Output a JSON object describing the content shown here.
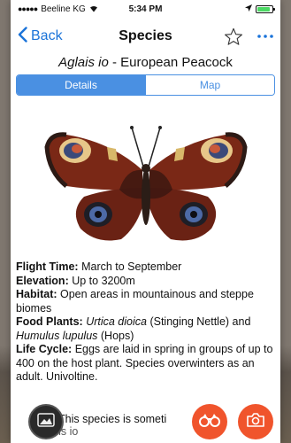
{
  "status": {
    "carrier": "Beeline KG",
    "time": "5:34 PM"
  },
  "nav": {
    "back_label": "Back",
    "title": "Species"
  },
  "species": {
    "latin": "Aglais io",
    "separator": " - ",
    "common": "European Peacock"
  },
  "tabs": [
    {
      "label": "Details",
      "active": true
    },
    {
      "label": "Map",
      "active": false
    }
  ],
  "details": {
    "flight_time_label": "Flight Time:",
    "flight_time_value": " March to September",
    "elevation_label": "Elevation:",
    "elevation_value": " Up to 3200m",
    "habitat_label": "Habitat:",
    "habitat_value": " Open areas in mountainous and steppe biomes",
    "food_label": "Food Plants:",
    "food_plant1": "Urtica dioica",
    "food_plant1_common": " (Stinging Nettle) and ",
    "food_plant2": "Humulus lupulus",
    "food_plant2_common": " (Hops)",
    "life_label": "Life Cycle:",
    "life_value": " Eggs are laid in spring in groups of up to 400 on the host plant. Species overwinters as an adult. Univoltine."
  },
  "caption": {
    "text": "This species is someti",
    "text_tail": "n",
    "latin_tail": "achis io"
  },
  "icons": {
    "gallery": "image-icon",
    "binoculars": "binoculars-icon",
    "camera": "camera-icon",
    "star": "star-icon",
    "more": "more-icon"
  },
  "colors": {
    "accent": "#1a73d9",
    "segment": "#4a90e2",
    "action": "#f0542c"
  }
}
